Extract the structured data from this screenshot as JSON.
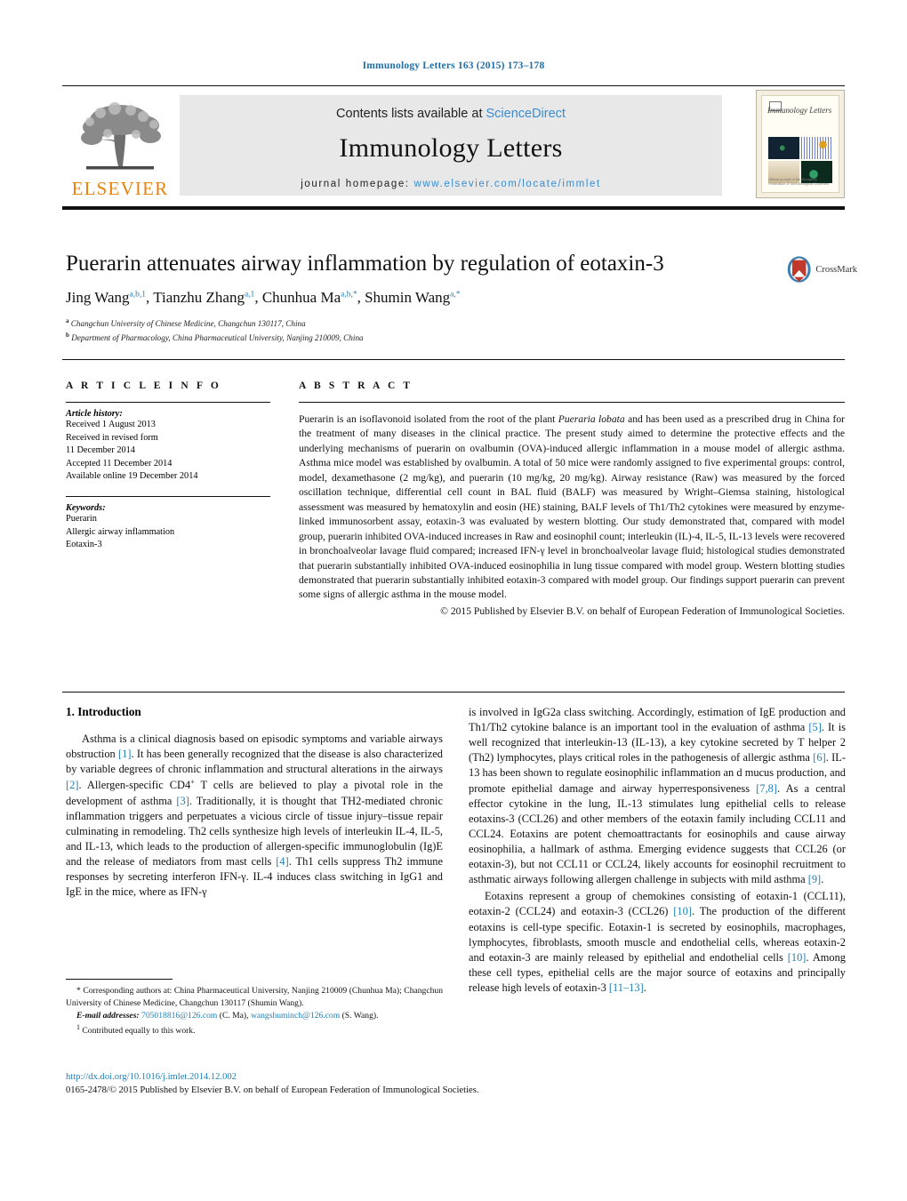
{
  "running_head": "Immunology Letters 163 (2015) 173–178",
  "masthead": {
    "publisher_logo_text": "ELSEVIER",
    "contents_prefix": "Contents lists available at ",
    "contents_link": "ScienceDirect",
    "journal_name": "Immunology Letters",
    "homepage_prefix": "journal homepage: ",
    "homepage_url": "www.elsevier.com/locate/immlet",
    "cover_title": "Immunology Letters",
    "cover_footer": "Official journal of the European Federation of Immunological Societies"
  },
  "article": {
    "title": "Puerarin attenuates airway inflammation by regulation of eotaxin-3",
    "crossmark_label": "CrossMark",
    "authors": [
      {
        "name": "Jing Wang",
        "marks": "a,b,1",
        "sep": ", "
      },
      {
        "name": "Tianzhu Zhang",
        "marks": "a,1",
        "sep": ", "
      },
      {
        "name": "Chunhua Ma",
        "marks": "a,b,*",
        "sep": ", "
      },
      {
        "name": "Shumin Wang",
        "marks": "a,*",
        "sep": ""
      }
    ],
    "affiliations": [
      {
        "mark": "a",
        "text": "Changchun University of Chinese Medicine, Changchun 130117, China"
      },
      {
        "mark": "b",
        "text": "Department of Pharmacology, China Pharmaceutical University, Nanjing 210009, China"
      }
    ]
  },
  "article_info": {
    "heading": "A R T I C L E   I N F O",
    "history_label": "Article history:",
    "history_lines": [
      "Received 1 August 2013",
      "Received in revised form",
      "11 December 2014",
      "Accepted 11 December 2014",
      "Available online 19 December 2014"
    ],
    "keywords_label": "Keywords:",
    "keywords": [
      "Puerarin",
      "Allergic airway inflammation",
      "Eotaxin-3"
    ]
  },
  "abstract": {
    "heading": "A B S T R A C T",
    "text_part1": "Puerarin is an isoflavonoid isolated from the root of the plant ",
    "text_italic": "Pueraria lobata",
    "text_part2": " and has been used as a prescribed drug in China for the treatment of many diseases in the clinical practice. The present study aimed to determine the protective effects and the underlying mechanisms of puerarin on ovalbumin (OVA)-induced allergic inflammation in a mouse model of allergic asthma. Asthma mice model was established by ovalbumin. A total of 50 mice were randomly assigned to five experimental groups: control, model, dexamethasone (2 mg/kg), and puerarin (10 mg/kg, 20 mg/kg). Airway resistance (Raw) was measured by the forced oscillation technique, differential cell count in BAL fluid (BALF) was measured by Wright–Giemsa staining, histological assessment was measured by hematoxylin and eosin (HE) staining, BALF levels of Th1/Th2 cytokines were measured by enzyme-linked immunosorbent assay, eotaxin-3 was evaluated by western blotting. Our study demonstrated that, compared with model group, puerarin inhibited OVA-induced increases in Raw and eosinophil count; interleukin (IL)-4, IL-5, IL-13 levels were recovered in bronchoalveolar lavage fluid compared; increased IFN-γ level in bronchoalveolar lavage fluid; histological studies demonstrated that puerarin substantially inhibited OVA-induced eosinophilia in lung tissue compared with model group. Western blotting studies demonstrated that puerarin substantially inhibited eotaxin-3 compared with model group. Our findings support puerarin can prevent some signs of allergic asthma in the mouse model.",
    "copyright": "© 2015 Published by Elsevier B.V. on behalf of European Federation of Immunological Societies."
  },
  "body": {
    "section_number_title": "1.  Introduction",
    "left_paragraph_1_a": "Asthma is a clinical diagnosis based on episodic symptoms and variable airways obstruction ",
    "ref1": "[1]",
    "left_paragraph_1_b": ". It has been generally recognized that the disease is also characterized by variable degrees of chronic inflammation and structural alterations in the airways ",
    "ref2": "[2]",
    "left_paragraph_1_c": ". Allergen-specific CD4",
    "sup_plus": "+",
    "left_paragraph_1_d": " T cells are believed to play a pivotal role in the development of asthma ",
    "ref3": "[3]",
    "left_paragraph_1_e": ". Traditionally, it is thought that TH2-mediated chronic inflammation triggers and perpetuates a vicious circle of tissue injury–tissue repair culminating in remodeling. Th2 cells synthesize high levels of interleukin IL-4, IL-5, and IL-13, which leads to the production of allergen-specific immunoglobulin (Ig)E and the release of mediators from mast cells ",
    "ref4": "[4]",
    "left_paragraph_1_f": ". Th1 cells suppress Th2 immune responses by secreting interferon IFN-γ. IL-4 induces class switching in IgG1 and IgE in the mice, where as IFN-γ",
    "right_paragraph_1_a": "is involved in IgG2a class switching. Accordingly, estimation of IgE production and Th1/Th2 cytokine balance is an important tool in the evaluation of asthma ",
    "ref5": "[5]",
    "right_paragraph_1_b": ". It is well recognized that interleukin-13 (IL-13), a key cytokine secreted by T helper 2 (Th2) lymphocytes, plays critical roles in the pathogenesis of allergic asthma ",
    "ref6": "[6]",
    "right_paragraph_1_c": ". IL-13 has been shown to regulate eosinophilic inflammation an d mucus production, and promote epithelial damage and airway hyperresponsiveness ",
    "ref78": "[7,8]",
    "right_paragraph_1_d": ". As a central effector cytokine in the lung, IL-13 stimulates lung epithelial cells to release eotaxins-3 (CCL26) and other members of the eotaxin family including CCL11 and CCL24. Eotaxins are potent chemoattractants for eosinophils and cause airway eosinophilia, a hallmark of asthma. Emerging evidence suggests that CCL26 (or eotaxin-3), but not CCL11 or CCL24, likely accounts for eosinophil recruitment to asthmatic airways following allergen challenge in subjects with mild asthma ",
    "ref9": "[9]",
    "right_paragraph_1_e": ".",
    "right_paragraph_2_a": "Eotaxins represent a group of chemokines consisting of eotaxin-1 (CCL11), eotaxin-2 (CCL24) and eotaxin-3 (CCL26) ",
    "ref10": "[10]",
    "right_paragraph_2_b": ". The production of the different eotaxins is cell-type specific. Eotaxin-1 is secreted by eosinophils, macrophages, lymphocytes, fibroblasts, smooth muscle and endothelial cells, whereas eotaxin-2 and eotaxin-3 are mainly released by epithelial and endothelial cells ",
    "ref10b": "[10]",
    "right_paragraph_2_c": ". Among these cell types, epithelial cells are the major source of eotaxins and principally release high levels of eotaxin-3 ",
    "ref1113": "[11–13]",
    "right_paragraph_2_d": "."
  },
  "footnotes": {
    "corresponding_mark": "*",
    "corresponding_text": " Corresponding authors at: China Pharmaceutical University, Nanjing 210009 (Chunhua Ma); Changchun University of Chinese Medicine, Changchun 130117 (Shumin Wang).",
    "email_label": "E-mail addresses:",
    "email_1": "705018816@126.com",
    "email_1_owner": " (C. Ma), ",
    "email_2": "wangshuminch@126.com",
    "email_2_owner": "(S. Wang).",
    "equal_mark": "1",
    "equal_text": " Contributed equally to this work."
  },
  "doc_footer": {
    "doi": "http://dx.doi.org/10.1016/j.imlet.2014.12.002",
    "issn_line": "0165-2478/© 2015 Published by Elsevier B.V. on behalf of European Federation of Immunological Societies."
  },
  "colors": {
    "link_blue": "#1f7fb5",
    "elsevier_orange": "#E8830C",
    "panel_grey": "#e8e8e8"
  }
}
